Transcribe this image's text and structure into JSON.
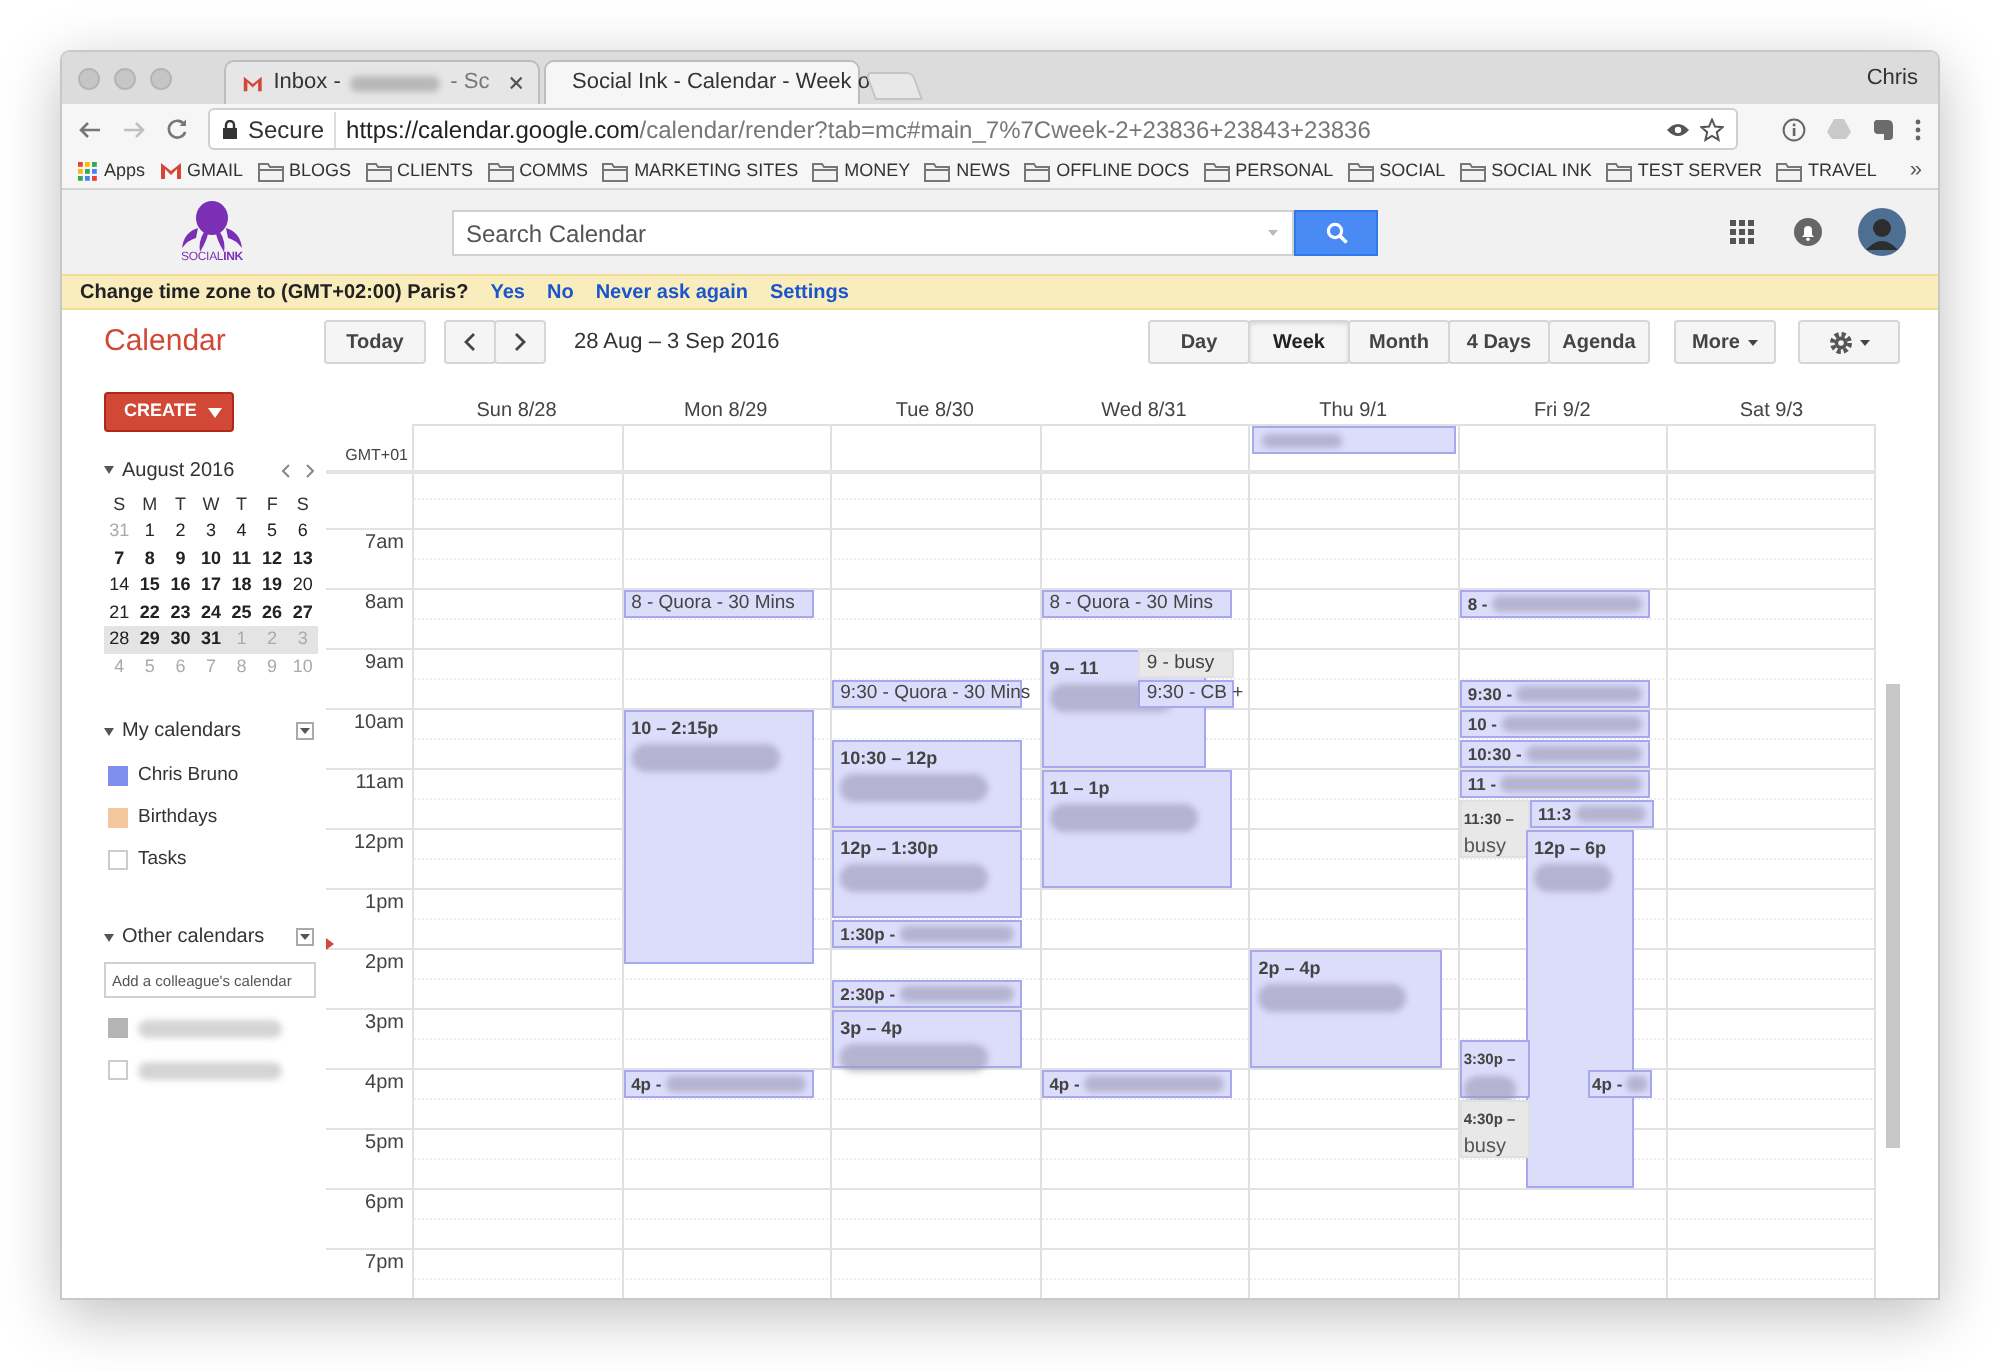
{
  "browser": {
    "tabs": [
      {
        "kind": "gmail",
        "label": "Inbox -",
        "blurred": true,
        "suffix": "- Sc",
        "selected": false
      },
      {
        "kind": "calendar",
        "label": "Social Ink - Calendar - Week o",
        "selected": true
      }
    ],
    "profile": "Chris",
    "secure_label": "Secure",
    "url_host": "https://calendar.google.com",
    "url_path": "/calendar/render?tab=mc#main_7%7Cweek-2+23836+23843+23836",
    "bookmarks": [
      {
        "kind": "apps",
        "label": "Apps"
      },
      {
        "kind": "gmail",
        "label": "GMAIL"
      },
      {
        "kind": "folder",
        "label": "BLOGS"
      },
      {
        "kind": "folder",
        "label": "CLIENTS"
      },
      {
        "kind": "folder",
        "label": "COMMS"
      },
      {
        "kind": "folder",
        "label": "MARKETING SITES"
      },
      {
        "kind": "folder",
        "label": "MONEY"
      },
      {
        "kind": "folder",
        "label": "NEWS"
      },
      {
        "kind": "folder",
        "label": "OFFLINE DOCS"
      },
      {
        "kind": "folder",
        "label": "PERSONAL"
      },
      {
        "kind": "folder",
        "label": "SOCIAL"
      },
      {
        "kind": "folder",
        "label": "SOCIAL INK"
      },
      {
        "kind": "folder",
        "label": "TEST SERVER"
      },
      {
        "kind": "folder",
        "label": "TRAVEL"
      }
    ],
    "bookmarks_more": "»"
  },
  "header": {
    "logo_text": "SOCIAL**INK**",
    "search_placeholder": "Search Calendar"
  },
  "notice": {
    "text": "Change time zone to (GMT+02:00) Paris?",
    "links": [
      "Yes",
      "No",
      "Never ask again",
      "Settings"
    ]
  },
  "toolbar": {
    "title": "Calendar",
    "today": "Today",
    "range": "28 Aug – 3 Sep 2016",
    "views": [
      {
        "label": "Day",
        "selected": false
      },
      {
        "label": "Week",
        "selected": true
      },
      {
        "label": "Month",
        "selected": false
      },
      {
        "label": "4 Days",
        "selected": false
      },
      {
        "label": "Agenda",
        "selected": false
      }
    ],
    "more": "More"
  },
  "sidebar": {
    "create": "CREATE",
    "mini_calendar": {
      "title": "August 2016",
      "weekdays": [
        "S",
        "M",
        "T",
        "W",
        "T",
        "F",
        "S"
      ],
      "weeks": [
        {
          "selected": false,
          "days": [
            {
              "d": "31",
              "muted": true,
              "bold": false
            },
            {
              "d": "1",
              "muted": false,
              "bold": false
            },
            {
              "d": "2",
              "muted": false,
              "bold": false
            },
            {
              "d": "3",
              "muted": false,
              "bold": false
            },
            {
              "d": "4",
              "muted": false,
              "bold": false
            },
            {
              "d": "5",
              "muted": false,
              "bold": false
            },
            {
              "d": "6",
              "muted": false,
              "bold": false
            }
          ]
        },
        {
          "selected": false,
          "days": [
            {
              "d": "7",
              "muted": false,
              "bold": true
            },
            {
              "d": "8",
              "muted": false,
              "bold": true
            },
            {
              "d": "9",
              "muted": false,
              "bold": true
            },
            {
              "d": "10",
              "muted": false,
              "bold": true
            },
            {
              "d": "11",
              "muted": false,
              "bold": true
            },
            {
              "d": "12",
              "muted": false,
              "bold": true
            },
            {
              "d": "13",
              "muted": false,
              "bold": true
            }
          ]
        },
        {
          "selected": false,
          "days": [
            {
              "d": "14",
              "muted": false,
              "bold": false
            },
            {
              "d": "15",
              "muted": false,
              "bold": true
            },
            {
              "d": "16",
              "muted": false,
              "bold": true
            },
            {
              "d": "17",
              "muted": false,
              "bold": true
            },
            {
              "d": "18",
              "muted": false,
              "bold": true
            },
            {
              "d": "19",
              "muted": false,
              "bold": true
            },
            {
              "d": "20",
              "muted": false,
              "bold": false
            }
          ]
        },
        {
          "selected": false,
          "days": [
            {
              "d": "21",
              "muted": false,
              "bold": false
            },
            {
              "d": "22",
              "muted": false,
              "bold": true
            },
            {
              "d": "23",
              "muted": false,
              "bold": true
            },
            {
              "d": "24",
              "muted": false,
              "bold": true
            },
            {
              "d": "25",
              "muted": false,
              "bold": true
            },
            {
              "d": "26",
              "muted": false,
              "bold": true
            },
            {
              "d": "27",
              "muted": false,
              "bold": true
            }
          ]
        },
        {
          "selected": true,
          "days": [
            {
              "d": "28",
              "muted": false,
              "bold": false
            },
            {
              "d": "29",
              "muted": false,
              "bold": true
            },
            {
              "d": "30",
              "muted": false,
              "bold": true
            },
            {
              "d": "31",
              "muted": false,
              "bold": true
            },
            {
              "d": "1",
              "muted": true,
              "bold": false
            },
            {
              "d": "2",
              "muted": true,
              "bold": false
            },
            {
              "d": "3",
              "muted": true,
              "bold": false
            }
          ]
        },
        {
          "selected": false,
          "days": [
            {
              "d": "4",
              "muted": true,
              "bold": false
            },
            {
              "d": "5",
              "muted": true,
              "bold": false
            },
            {
              "d": "6",
              "muted": true,
              "bold": false
            },
            {
              "d": "7",
              "muted": true,
              "bold": false
            },
            {
              "d": "8",
              "muted": true,
              "bold": false
            },
            {
              "d": "9",
              "muted": true,
              "bold": false
            },
            {
              "d": "10",
              "muted": true,
              "bold": false
            }
          ]
        }
      ]
    },
    "my_calendars": {
      "title": "My calendars",
      "items": [
        {
          "name": "Chris Bruno",
          "checked": true,
          "color": "#7f8ff0"
        },
        {
          "name": "Birthdays",
          "checked": true,
          "color": "#f3c79c"
        },
        {
          "name": "Tasks",
          "checked": false
        }
      ]
    },
    "other_calendars": {
      "title": "Other calendars",
      "placeholder": "Add a colleague's calendar",
      "items": [
        {
          "checked": true,
          "color": "#b4b4b4",
          "blurred": true
        },
        {
          "checked": false,
          "blurred": true
        }
      ]
    }
  },
  "week": {
    "timezone": "GMT+01",
    "hours": [
      "7am",
      "8am",
      "9am",
      "10am",
      "11am",
      "12pm",
      "1pm",
      "2pm",
      "3pm",
      "4pm",
      "5pm",
      "6pm",
      "7pm"
    ],
    "days": [
      {
        "label": "Sun 8/28"
      },
      {
        "label": "Mon 8/29",
        "events": [
          {
            "kind": "event",
            "label": "8 - Quora - 30 Mins",
            "blurred": false
          },
          {
            "kind": "event",
            "label": "10 – 2:15p",
            "blurred": true
          },
          {
            "kind": "event",
            "label": "4p -",
            "blurred": true
          }
        ]
      },
      {
        "label": "Tue 8/30",
        "events": [
          {
            "kind": "event",
            "label": "9:30 - Quora - 30 Mins",
            "blurred": false
          },
          {
            "kind": "event",
            "label": "10:30 – 12p",
            "blurred": true
          },
          {
            "kind": "event",
            "label": "12p – 1:30p",
            "blurred": true
          },
          {
            "kind": "event",
            "label": "1:30p -",
            "blurred": true
          },
          {
            "kind": "event",
            "label": "2:30p -",
            "blurred": true
          },
          {
            "kind": "event",
            "label": "3p – 4p",
            "blurred": true
          }
        ]
      },
      {
        "label": "Wed 8/31",
        "events": [
          {
            "kind": "event",
            "label": "8 - Quora - 30 Mins",
            "blurred": false
          },
          {
            "kind": "event",
            "label": "9 – 11",
            "blurred": true
          },
          {
            "kind": "busy",
            "label": "9 - busy",
            "blurred": false
          },
          {
            "kind": "event",
            "label": "9:30 - CB +",
            "blurred": false
          },
          {
            "kind": "event",
            "label": "11 – 1p",
            "blurred": true
          },
          {
            "kind": "event",
            "label": "4p -",
            "blurred": true
          }
        ]
      },
      {
        "label": "Thu 9/1",
        "all_day": [
          {
            "blurred": true
          }
        ],
        "events": [
          {
            "kind": "event",
            "label": "2p – 4p",
            "blurred": true
          }
        ]
      },
      {
        "label": "Fri 9/2",
        "events": [
          {
            "kind": "event",
            "label": "8 -",
            "blurred": true
          },
          {
            "kind": "event",
            "label": "9:30 -",
            "blurred": true
          },
          {
            "kind": "event",
            "label": "10 -",
            "blurred": true
          },
          {
            "kind": "event",
            "label": "10:30 -",
            "blurred": true
          },
          {
            "kind": "event",
            "label": "11 -",
            "blurred": true
          },
          {
            "kind": "busy",
            "label": "11:30 –",
            "sublabel": "busy",
            "blurred": false
          },
          {
            "kind": "event",
            "label": "11:3",
            "blurred": true
          },
          {
            "kind": "event",
            "label": "12p – 6p",
            "blurred": true
          },
          {
            "kind": "event",
            "label": "3:30p –",
            "blurred": true
          },
          {
            "kind": "busy",
            "label": "4:30p –",
            "sublabel": "busy",
            "blurred": false
          },
          {
            "kind": "event",
            "label": "4p -",
            "blurred": true
          }
        ]
      },
      {
        "label": "Sat 9/3"
      }
    ]
  }
}
